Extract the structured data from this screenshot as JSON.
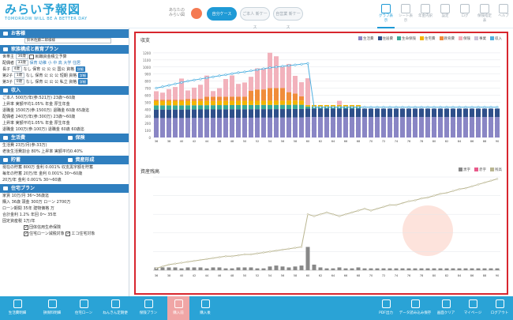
{
  "header": {
    "logo_title": "みらい予報図",
    "logo_sub": "TOMORROW WILL BE A BETTER DAY",
    "case_label": "あなたのみらい図",
    "cases": [
      "自分ケース",
      "ご本人 新ケース",
      "自営業 新ケース"
    ],
    "nav": [
      "グラフ表示",
      "シート表示",
      "年金内訳",
      "設定",
      "ログ",
      "保険指定表",
      "ヘルプ"
    ]
  },
  "sidebar": {
    "customer_h": "お客様",
    "customer_value": "鈴木佐藤二郎様様",
    "family_h": "家族構成と教育プラン",
    "family_rows": [
      {
        "rel": "世帯主",
        "age": "36歳",
        "note": "就職資金積立予算"
      },
      {
        "rel": "配偶者",
        "age": "33歳",
        "note": "保育 幼稚 小 中 高 大学 住居"
      },
      {
        "rel": "長子",
        "age": "4歳",
        "note": "なし 保育 公 公 公 国公 資格"
      },
      {
        "rel": "第2子",
        "age": "1歳",
        "note": "なし 保育 公 公 公 短期 資格"
      },
      {
        "rel": "第3子",
        "age": "0歳",
        "note": "なし 保育 公 公 公 私立 資格"
      }
    ],
    "income_h": "収入",
    "income_rows": [
      "ご本人 500万/年(参:521万) 23歳～60歳",
      "上昇率 実額平均1.05% 年金 厚生年金",
      "退職金 1500万(参:1500万) 退職金 60歳 65歳迄",
      "配偶者 240万/年(参:300万) 23歳～60歳",
      "上昇率 実額平均1.05% 年金 厚生年金",
      "退職金 100万(参:100万) 退職金 60歳 60歳迄"
    ],
    "expense_h": "生活費",
    "insurance_h": "保険",
    "expense_rows": [
      "生活費 23万/月(参:33万)",
      "老後生活費割合 80% 上昇率 実額平均0.40%"
    ],
    "savings_h": "貯蓄",
    "asset_h": "資産形成",
    "savings_rows": [
      "現在の貯蓄 800万 金利 0.001% 収支黒字額を貯蓄",
      "毎年の貯蓄 20万/年 金利 0.001% 30～60歳",
      "20万/年 金利 0.001% 30～60歳"
    ],
    "housing_h": "住宅プラン",
    "housing_rows": [
      "家賃 10万/月 36～36歳迄",
      "購入 36歳 頭金 300万 ローン 2700万",
      "ローン期間 35年 建物価格 万",
      "合計金利 1.2% 年回 0～ 35年",
      "固定資産税 1万/年"
    ],
    "housing_checks": [
      "団体信用生命保険",
      "住宅ローン減税対象",
      "エコ住宅対象"
    ]
  },
  "chart_titles": {
    "top": "収支",
    "bottom": "資産残高"
  },
  "legend_top": [
    "生活費",
    "住居費",
    "生命保険",
    "住宅費",
    "教育費",
    "保険",
    "事業",
    "収入"
  ],
  "legend_bottom": [
    "黒字",
    "赤字",
    "残高"
  ],
  "tabs": [
    "生活費明細",
    "損保料明細",
    "住宅ローン",
    "ねんきん定期便",
    "保険プラン",
    "購入前",
    "購入後",
    "PDF出力",
    "データ読み込み保存",
    "画面クリア",
    "マイページ",
    "ログアウト"
  ],
  "colors": {
    "accent": "#2aa3d6",
    "blue": "#2f7fbf",
    "red_frame": "#d8262e",
    "pink_tab": "#f0a6a6"
  },
  "chart_data": [
    {
      "type": "bar",
      "title": "収支",
      "x": [
        36,
        37,
        38,
        39,
        40,
        41,
        42,
        43,
        44,
        45,
        46,
        47,
        48,
        49,
        50,
        51,
        52,
        53,
        54,
        55,
        56,
        57,
        58,
        59,
        60,
        61,
        62,
        63,
        64,
        65,
        66,
        67,
        68,
        69,
        70,
        71,
        72,
        73,
        74,
        75,
        76,
        77,
        78,
        79,
        80,
        81,
        82,
        83,
        84,
        85,
        86,
        87,
        88,
        89,
        90
      ],
      "ylim": [
        0,
        1300
      ],
      "yticks": [
        0,
        100,
        200,
        300,
        400,
        500,
        600,
        700,
        800,
        900,
        1000,
        1100,
        1200
      ],
      "series": [
        {
          "name": "生活費",
          "values": [
            276,
            276,
            276,
            276,
            276,
            277,
            277,
            278,
            278,
            278,
            279,
            279,
            280,
            280,
            280,
            281,
            281,
            282,
            282,
            282,
            283,
            283,
            284,
            284,
            290,
            290,
            290,
            290,
            290,
            290,
            290,
            290,
            290,
            290,
            290,
            290,
            290,
            290,
            290,
            290,
            290,
            290,
            290,
            290,
            290,
            290,
            290,
            290,
            290,
            290,
            290,
            290,
            290,
            290,
            290
          ]
        },
        {
          "name": "住居費",
          "values": [
            120,
            120,
            120,
            120,
            120,
            120,
            120,
            120,
            120,
            120,
            120,
            120,
            120,
            120,
            120,
            120,
            120,
            120,
            120,
            120,
            120,
            120,
            120,
            120,
            120,
            120,
            120,
            120,
            120,
            120,
            120,
            120,
            120,
            120,
            120,
            120,
            120,
            120,
            120,
            120,
            120,
            120,
            120,
            120,
            120,
            120,
            120,
            120,
            120,
            120,
            120,
            120,
            120,
            120,
            120
          ]
        },
        {
          "name": "生命保険",
          "values": [
            60,
            60,
            60,
            60,
            60,
            60,
            60,
            60,
            60,
            60,
            60,
            60,
            60,
            60,
            60,
            60,
            60,
            60,
            60,
            60,
            60,
            60,
            60,
            60,
            30,
            30,
            30,
            30,
            30,
            30,
            30,
            30,
            30,
            0,
            0,
            0,
            0,
            0,
            0,
            0,
            0,
            0,
            0,
            0,
            0,
            0,
            0,
            0,
            0,
            0,
            0,
            0,
            0,
            0,
            0
          ]
        },
        {
          "name": "住宅費",
          "values": [
            60,
            60,
            60,
            60,
            60,
            60,
            60,
            60,
            60,
            60,
            60,
            60,
            60,
            60,
            60,
            60,
            60,
            60,
            60,
            60,
            60,
            60,
            60,
            60,
            20,
            20,
            20,
            20,
            20,
            20,
            20,
            20,
            20,
            0,
            0,
            0,
            0,
            0,
            0,
            0,
            0,
            0,
            0,
            0,
            0,
            0,
            0,
            0,
            0,
            0,
            0,
            0,
            0,
            0,
            0
          ]
        },
        {
          "name": "教育費",
          "values": [
            20,
            20,
            20,
            20,
            20,
            30,
            30,
            30,
            60,
            60,
            60,
            60,
            60,
            60,
            60,
            140,
            160,
            160,
            180,
            180,
            180,
            120,
            100,
            60,
            0,
            0,
            0,
            0,
            0,
            0,
            0,
            0,
            0,
            0,
            0,
            0,
            0,
            0,
            0,
            0,
            0,
            0,
            0,
            0,
            0,
            0,
            0,
            0,
            0,
            0,
            0,
            0,
            0,
            0,
            0
          ]
        },
        {
          "name": "保険",
          "values": [
            120,
            100,
            150,
            180,
            300,
            120,
            160,
            200,
            300,
            80,
            120,
            250,
            300,
            180,
            200,
            200,
            300,
            300,
            500,
            450,
            300,
            400,
            250,
            200,
            380,
            0,
            0,
            0,
            0,
            60,
            0,
            0,
            0,
            0,
            0,
            0,
            0,
            0,
            0,
            0,
            0,
            0,
            0,
            0,
            0,
            0,
            0,
            0,
            0,
            0,
            0,
            0,
            0,
            0,
            0
          ]
        },
        {
          "name": "収入",
          "values": [
            700,
            720,
            740,
            760,
            780,
            800,
            815,
            830,
            845,
            860,
            875,
            890,
            905,
            920,
            930,
            945,
            960,
            975,
            990,
            1000,
            1010,
            1020,
            1030,
            1040,
            1050,
            430,
            430,
            430,
            430,
            430,
            430,
            430,
            430,
            430,
            430,
            430,
            430,
            430,
            430,
            430,
            430,
            430,
            430,
            430,
            430,
            430,
            430,
            430,
            430,
            430,
            430,
            430,
            430,
            430,
            430
          ]
        }
      ]
    },
    {
      "type": "line",
      "title": "資産残高",
      "x": [
        36,
        37,
        38,
        39,
        40,
        41,
        42,
        43,
        44,
        45,
        46,
        47,
        48,
        49,
        50,
        51,
        52,
        53,
        54,
        55,
        56,
        57,
        58,
        59,
        60,
        61,
        62,
        63,
        64,
        65,
        66,
        67,
        68,
        69,
        70,
        71,
        72,
        73,
        74,
        75,
        76,
        77,
        78,
        79,
        80,
        81,
        82,
        83,
        84,
        85,
        86,
        87,
        88,
        89,
        90
      ],
      "series": [
        {
          "name": "残高",
          "values": [
            0.02,
            0.04,
            0.06,
            0.07,
            0.08,
            0.09,
            0.1,
            0.11,
            0.12,
            0.13,
            0.14,
            0.15,
            0.15,
            0.16,
            0.17,
            0.17,
            0.18,
            0.19,
            0.2,
            0.21,
            0.22,
            0.23,
            0.24,
            0.25,
            0.6,
            0.58,
            0.6,
            0.62,
            0.6,
            0.58,
            0.6,
            0.62,
            0.64,
            0.66,
            0.64,
            0.66,
            0.68,
            0.7,
            0.7,
            0.72,
            0.74,
            0.75,
            0.77,
            0.78,
            0.8,
            0.82,
            0.83,
            0.85,
            0.87,
            0.88,
            0.9,
            0.92,
            0.94,
            0.96,
            0.98
          ]
        },
        {
          "name": "黒字",
          "values": [
            0.03,
            0.03,
            0.03,
            0.03,
            0.02,
            0.03,
            0.03,
            0.03,
            0.02,
            0.03,
            0.03,
            0.02,
            0.02,
            0.03,
            0.03,
            0.03,
            0.02,
            0.02,
            0.04,
            0.05,
            0.04,
            0.03,
            0.04,
            0.05,
            0.25,
            0.06,
            0.03,
            0.02,
            0.02,
            0.03,
            0.02,
            0.02,
            0.03,
            0.02,
            0.02,
            0.02,
            0.02,
            0.02,
            0.02,
            0.02,
            0.02,
            0.02,
            0.02,
            0.02,
            0.02,
            0.02,
            0.02,
            0.02,
            0.02,
            0.02,
            0.02,
            0.02,
            0.02,
            0.02,
            0.02
          ]
        }
      ]
    }
  ]
}
